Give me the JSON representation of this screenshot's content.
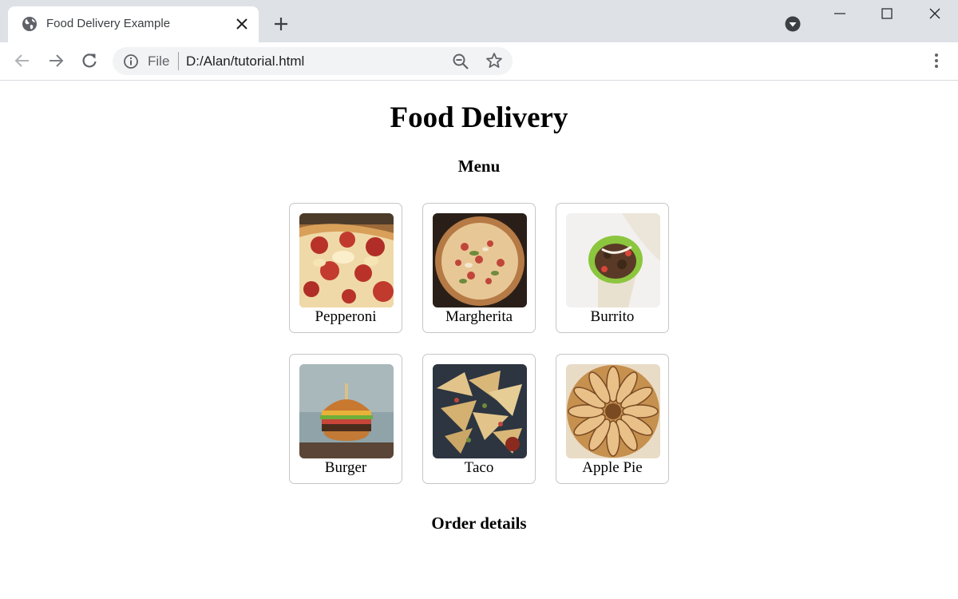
{
  "browser": {
    "tab": {
      "title": "Food Delivery Example"
    },
    "address_bar": {
      "scheme_label": "File",
      "url": "D:/Alan/tutorial.html"
    }
  },
  "page": {
    "title": "Food Delivery",
    "menu_heading": "Menu",
    "menu_items": [
      {
        "name": "Pepperoni",
        "image": "pepperoni-pizza-photo"
      },
      {
        "name": "Margherita",
        "image": "margherita-pizza-photo"
      },
      {
        "name": "Burrito",
        "image": "burrito-photo"
      },
      {
        "name": "Burger",
        "image": "burger-photo"
      },
      {
        "name": "Taco",
        "image": "taco-photo"
      },
      {
        "name": "Apple Pie",
        "image": "apple-pie-photo"
      }
    ],
    "order_heading": "Order details"
  },
  "colors": {
    "titlebar": "#dee1e6",
    "omnibox": "#f1f3f4",
    "card_border": "#c6c6c6",
    "text": "#000000"
  }
}
